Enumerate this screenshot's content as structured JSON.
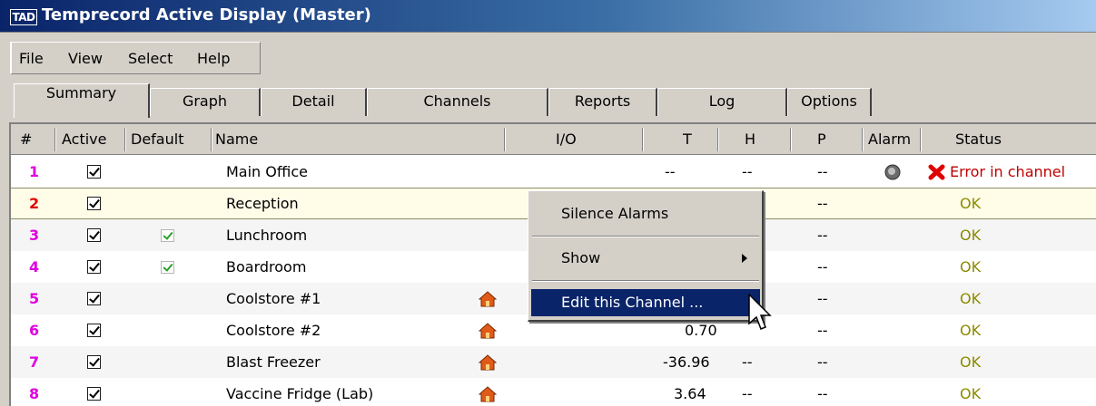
{
  "window": {
    "icon_text": "TAD",
    "title": "Temprecord Active Display (Master)"
  },
  "menu": [
    "File",
    "View",
    "Select",
    "Help"
  ],
  "tabs": [
    "Summary",
    "Graph",
    "Detail",
    "Channels",
    "Reports",
    "Log",
    "Options"
  ],
  "active_tab": "Summary",
  "columns": [
    "#",
    "Active",
    "Default",
    "Name",
    "I/O",
    "T",
    "H",
    "P",
    "Alarm",
    "Status"
  ],
  "rows": [
    {
      "num": "1",
      "active": true,
      "default": false,
      "name": "Main Office",
      "io": "",
      "t": "--",
      "h": "--",
      "p": "--",
      "alarm": "speaker",
      "status": "Error in channel",
      "state": "error"
    },
    {
      "num": "2",
      "active": true,
      "default": false,
      "name": "Reception",
      "io": "",
      "t": "",
      "h": "",
      "p": "--",
      "alarm": "",
      "status": "OK",
      "state": "ok"
    },
    {
      "num": "3",
      "active": true,
      "default": true,
      "name": "Lunchroom",
      "io": "",
      "t": "",
      "h": "",
      "p": "--",
      "alarm": "",
      "status": "OK",
      "state": "ok"
    },
    {
      "num": "4",
      "active": true,
      "default": true,
      "name": "Boardroom",
      "io": "",
      "t": "",
      "h": "",
      "p": "--",
      "alarm": "",
      "status": "OK",
      "state": "ok"
    },
    {
      "num": "5",
      "active": true,
      "default": false,
      "name": "Coolstore #1",
      "io": "house",
      "t": "",
      "h": "",
      "p": "--",
      "alarm": "",
      "status": "OK",
      "state": "ok"
    },
    {
      "num": "6",
      "active": true,
      "default": false,
      "name": "Coolstore #2",
      "io": "house",
      "t": "0.70",
      "h": "",
      "p": "--",
      "alarm": "",
      "status": "OK",
      "state": "ok"
    },
    {
      "num": "7",
      "active": true,
      "default": false,
      "name": "Blast Freezer",
      "io": "house",
      "t": "-36.96",
      "h": "--",
      "p": "--",
      "alarm": "",
      "status": "OK",
      "state": "ok"
    },
    {
      "num": "8",
      "active": true,
      "default": false,
      "name": "Vaccine Fridge (Lab)",
      "io": "house",
      "t": "3.64",
      "h": "--",
      "p": "--",
      "alarm": "",
      "status": "OK",
      "state": "ok"
    }
  ],
  "context_menu": {
    "items": [
      "Silence Alarms",
      "Show",
      "Edit this Channel ..."
    ],
    "highlighted": "Edit this Channel ..."
  },
  "colors": {
    "title_start": "#0a246a",
    "title_end": "#a6caf0",
    "row_number": "#e000e0",
    "selected_number": "#e00000",
    "ok": "#8b8b00",
    "error": "#c00000",
    "highlight": "#0a246a"
  }
}
